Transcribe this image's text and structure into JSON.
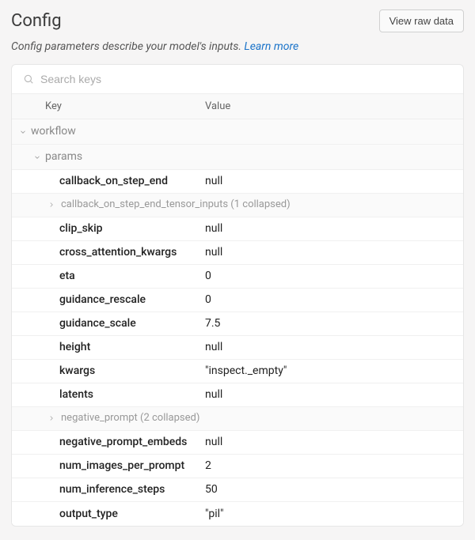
{
  "header": {
    "title": "Config",
    "view_raw_label": "View raw data"
  },
  "subtitle": {
    "text": "Config parameters describe your model's inputs. ",
    "link_text": "Learn more"
  },
  "search": {
    "placeholder": "Search keys"
  },
  "columns": {
    "key": "Key",
    "value": "Value"
  },
  "groups": {
    "workflow": "workflow",
    "params": "params"
  },
  "collapsed": {
    "cb_tensor": "callback_on_step_end_tensor_inputs (1 collapsed)",
    "neg_prompt": "negative_prompt (2 collapsed)"
  },
  "rows": {
    "callback_on_step_end": {
      "key": "callback_on_step_end",
      "value": "null"
    },
    "clip_skip": {
      "key": "clip_skip",
      "value": "null"
    },
    "cross_attention_kwargs": {
      "key": "cross_attention_kwargs",
      "value": "null"
    },
    "eta": {
      "key": "eta",
      "value": "0"
    },
    "guidance_rescale": {
      "key": "guidance_rescale",
      "value": "0"
    },
    "guidance_scale": {
      "key": "guidance_scale",
      "value": "7.5"
    },
    "height": {
      "key": "height",
      "value": "null"
    },
    "kwargs": {
      "key": "kwargs",
      "value": "\"inspect._empty\""
    },
    "latents": {
      "key": "latents",
      "value": "null"
    },
    "negative_prompt_embeds": {
      "key": "negative_prompt_embeds",
      "value": "null"
    },
    "num_images_per_prompt": {
      "key": "num_images_per_prompt",
      "value": "2"
    },
    "num_inference_steps": {
      "key": "num_inference_steps",
      "value": "50"
    },
    "output_type": {
      "key": "output_type",
      "value": "\"pil\""
    }
  }
}
